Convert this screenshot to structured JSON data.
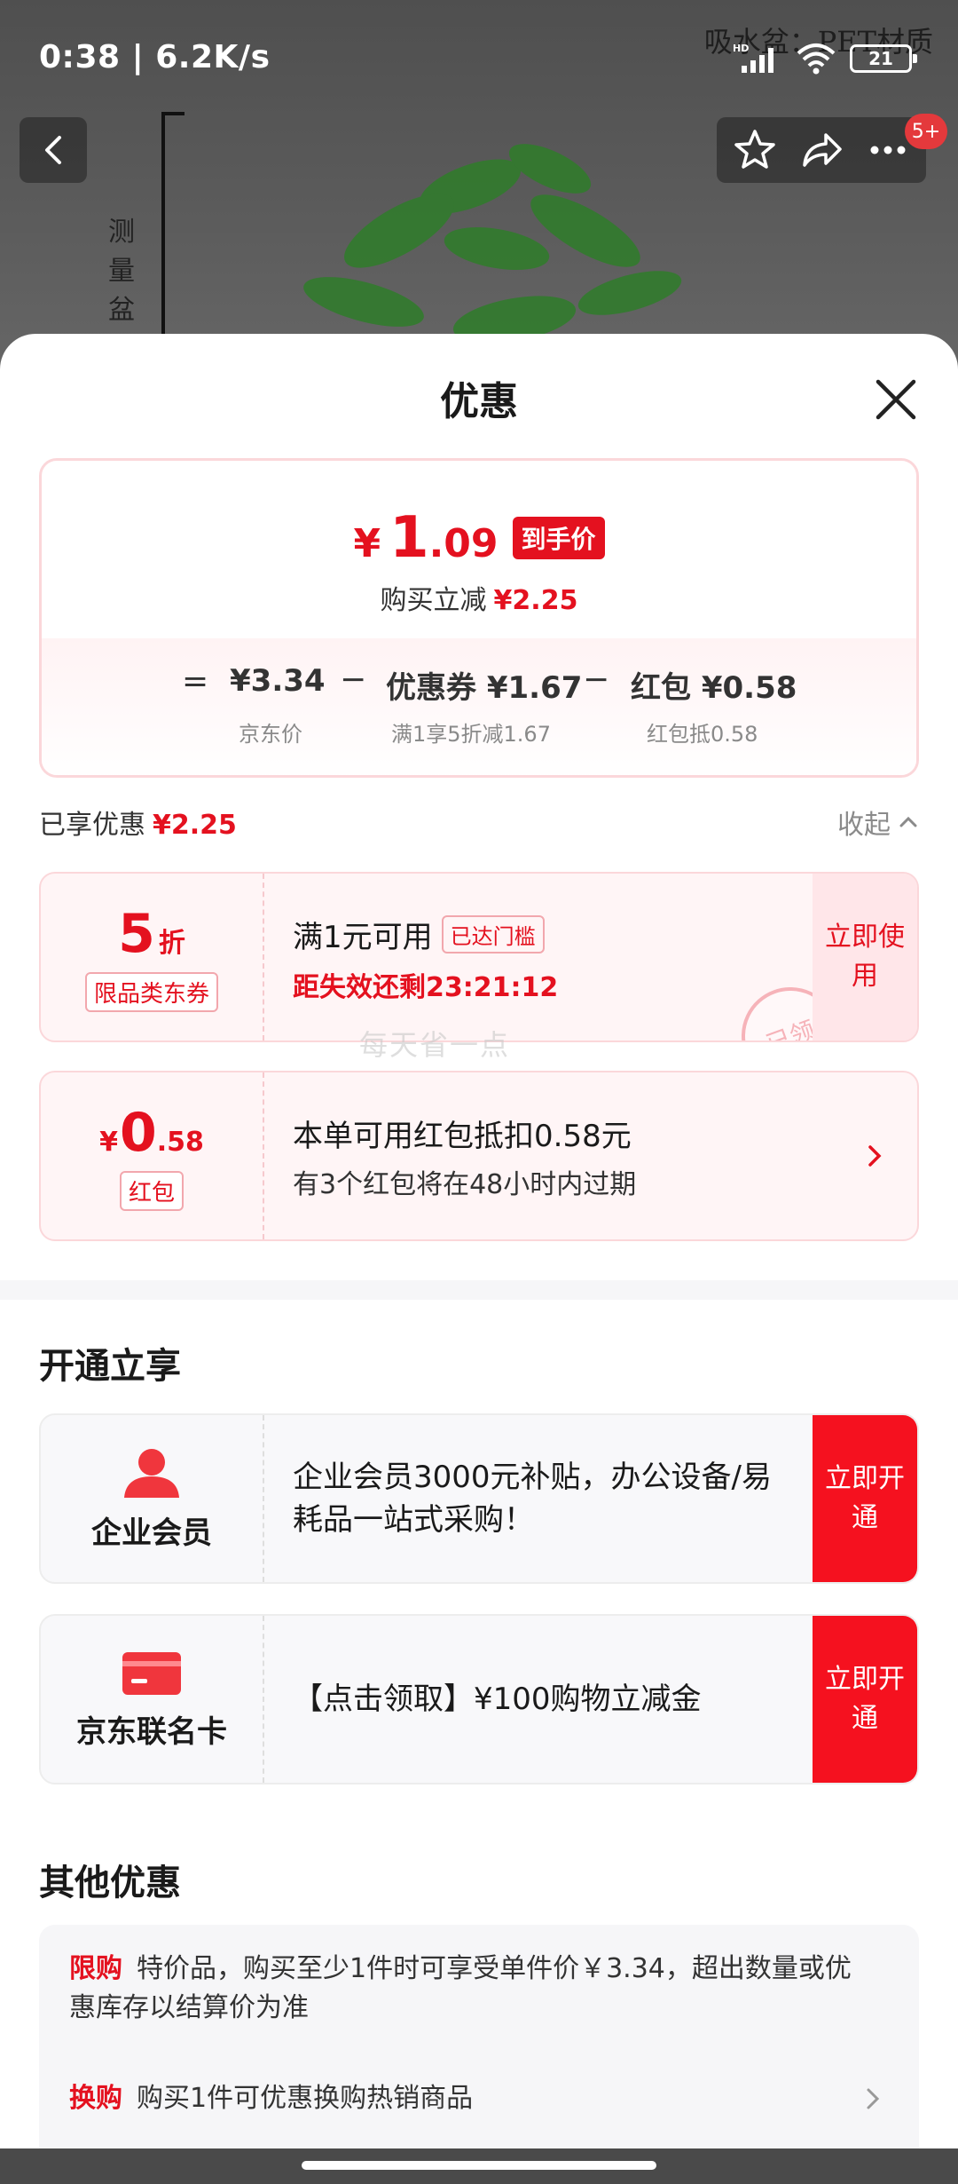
{
  "status_bar": {
    "time_speed": "0:38 | 6.2K/s",
    "battery": "21",
    "icons": [
      "hd-signal-icon",
      "wifi-icon",
      "battery-icon"
    ]
  },
  "background": {
    "watermark_text": "吸水盆：PET材质",
    "vertical_text": "测量盆底",
    "cart_badge": "5+"
  },
  "sheet": {
    "title": "优惠"
  },
  "summary": {
    "yen": "¥",
    "price_int": "1",
    "price_dec": ".09",
    "price_tag": "到手价",
    "reduce_label": "购买立减",
    "reduce_value": "¥2.25",
    "eq": "=",
    "minus": "−",
    "jd_price": "¥3.34",
    "jd_price_label": "京东价",
    "coupon_text": "优惠券 ¥1.67",
    "coupon_sub": "满1享5折减1.67",
    "redpack_text": "红包 ¥0.58",
    "redpack_sub": "红包抵0.58"
  },
  "enjoyed": {
    "label": "已享优惠",
    "value": "¥2.25",
    "collapse": "收起"
  },
  "coupon_card": {
    "value": "5",
    "unit": "折",
    "label": "限品类东券",
    "condition": "满1元可用",
    "reached": "已达门槛",
    "expire": "距失效还剩23:21:12",
    "button": "立即使用",
    "stamp": "已领",
    "watermark": "每天省一点"
  },
  "redpack_card": {
    "yen": "¥",
    "value_int": "0",
    "value_dec": ".58",
    "label": "红包",
    "line1": "本单可用红包抵扣0.58元",
    "line2": "有3个红包将在48小时内过期"
  },
  "open_section": {
    "title": "开通立享",
    "items": [
      {
        "name": "企业会员",
        "text": "企业会员3000元补贴，办公设备/易耗品一站式采购！",
        "button": "立即开通"
      },
      {
        "name": "京东联名卡",
        "text": "【点击领取】¥100购物立减金",
        "button": "立即开通"
      }
    ]
  },
  "other_section": {
    "title": "其他优惠",
    "rows": [
      {
        "tag": "限购",
        "text": "特价品，购买至少1件时可享受单件价￥3.34，超出数量或优惠库存以结算价为准"
      },
      {
        "tag": "换购",
        "text": "购买1件可优惠换购热销商品"
      }
    ]
  },
  "colors": {
    "accent": "#e4111f",
    "open_button": "#f5111f",
    "card_pink": "#fff5f6"
  }
}
